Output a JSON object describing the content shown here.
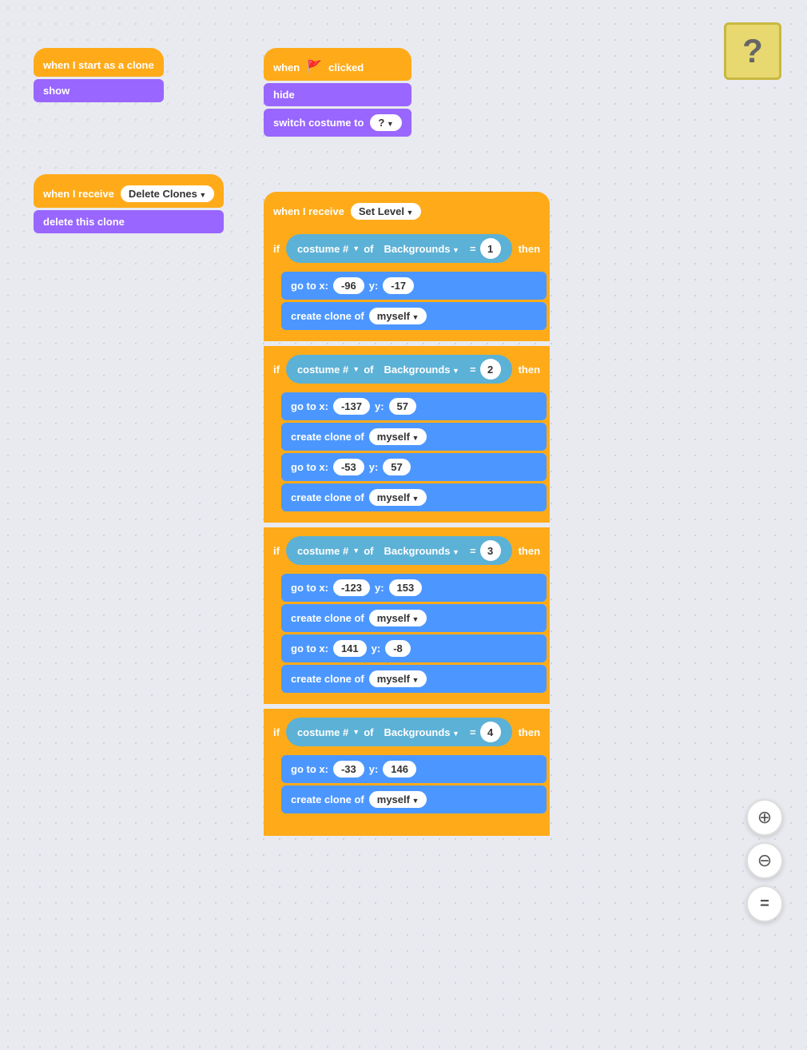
{
  "sprite": {
    "label": "?"
  },
  "stack1": {
    "hat": "when I start as a clone",
    "blocks": [
      "show"
    ]
  },
  "stack2": {
    "hat": "when I receive",
    "message": "Delete Clones",
    "blocks": [
      "delete this clone"
    ]
  },
  "stack3": {
    "hat_event": "when",
    "hat_flag": "🚩",
    "hat_suffix": "clicked",
    "blocks": [
      "hide"
    ],
    "costume_label": "switch costume to",
    "costume_value": "?"
  },
  "mainStack": {
    "hat": "when I receive",
    "message": "Set Level",
    "conditions": [
      {
        "costume_num": "1",
        "gotoX": "-96",
        "gotoY": "-17",
        "clones": 1
      },
      {
        "costume_num": "2",
        "gotoX": "-137",
        "gotoY": "57",
        "gotoX2": "-53",
        "gotoY2": "57",
        "clones": 2
      },
      {
        "costume_num": "3",
        "gotoX": "-123",
        "gotoY": "153",
        "gotoX2": "141",
        "gotoY2": "-8",
        "clones": 2
      },
      {
        "costume_num": "4",
        "gotoX": "-33",
        "gotoY": "146",
        "clones": 1
      }
    ]
  },
  "labels": {
    "when_start_clone": "when I start as a clone",
    "show": "show",
    "when_receive": "when I receive",
    "delete_clones": "Delete Clones",
    "delete_clone": "delete this clone",
    "when": "when",
    "clicked": "clicked",
    "hide": "hide",
    "switch_costume": "switch costume to",
    "set_level": "Set Level",
    "if_label": "if",
    "then_label": "then",
    "costume_hash": "costume #",
    "of_label": "of",
    "backgrounds": "Backgrounds",
    "goto_x": "go to x:",
    "y_label": "y:",
    "create_clone": "create clone of",
    "myself": "myself",
    "zoom_in": "+",
    "zoom_out": "−",
    "fit": "="
  }
}
